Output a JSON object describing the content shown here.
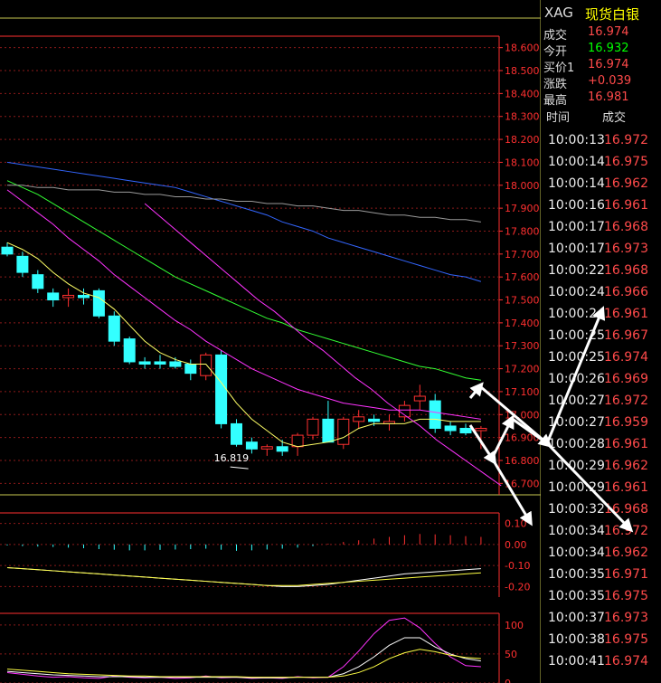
{
  "symbol": {
    "code": "XAG",
    "name": "现货白银"
  },
  "quote": {
    "rows": [
      {
        "label": "成交",
        "value": "16.974",
        "color": "#ff4a4a"
      },
      {
        "label": "今开",
        "value": "16.932",
        "color": "#00ff00"
      },
      {
        "label": "买价1",
        "value": "16.974",
        "color": "#ff4a4a"
      },
      {
        "label": "涨跌",
        "value": "+0.039",
        "color": "#ff4a4a"
      },
      {
        "label": "最高",
        "value": "16.981",
        "color": "#ff4a4a"
      }
    ]
  },
  "ticks": {
    "header_time": "时间",
    "header_price": "成交",
    "rows": [
      {
        "time": "10:00:13",
        "price": "16.972"
      },
      {
        "time": "10:00:14",
        "price": "16.975"
      },
      {
        "time": "10:00:14",
        "price": "16.962"
      },
      {
        "time": "10:00:16",
        "price": "16.961"
      },
      {
        "time": "10:00:17",
        "price": "16.968"
      },
      {
        "time": "10:00:17",
        "price": "16.973"
      },
      {
        "time": "10:00:22",
        "price": "16.968"
      },
      {
        "time": "10:00:24",
        "price": "16.966"
      },
      {
        "time": "10:00:24",
        "price": "16.961"
      },
      {
        "time": "10:00:25",
        "price": "16.967"
      },
      {
        "time": "10:00:25",
        "price": "16.974"
      },
      {
        "time": "10:00:26",
        "price": "16.969"
      },
      {
        "time": "10:00:27",
        "price": "16.972"
      },
      {
        "time": "10:00:27",
        "price": "16.959"
      },
      {
        "time": "10:00:28",
        "price": "16.961"
      },
      {
        "time": "10:00:29",
        "price": "16.962"
      },
      {
        "time": "10:00:29",
        "price": "16.961"
      },
      {
        "time": "10:00:32",
        "price": "16.968"
      },
      {
        "time": "10:00:34",
        "price": "16.972"
      },
      {
        "time": "10:00:34",
        "price": "16.962"
      },
      {
        "time": "10:00:35",
        "price": "16.971"
      },
      {
        "time": "10:00:35",
        "price": "16.975"
      },
      {
        "time": "10:00:37",
        "price": "16.973"
      },
      {
        "time": "10:00:38",
        "price": "16.975"
      },
      {
        "time": "10:00:41",
        "price": "16.974"
      }
    ]
  },
  "colors": {
    "up": "#ff3030",
    "down": "#33ffff",
    "grid": "#8b1a1a",
    "axis": "#ff3030"
  },
  "chart_data": {
    "type": "candlestick",
    "ylim": [
      16.65,
      18.65
    ],
    "yticks": [
      "18.600",
      "18.500",
      "18.400",
      "18.300",
      "18.200",
      "18.100",
      "18.000",
      "17.900",
      "17.800",
      "17.700",
      "17.600",
      "17.500",
      "17.400",
      "17.300",
      "17.200",
      "17.100",
      "17.000",
      "16.900",
      "16.800",
      "16.700"
    ],
    "low_annotation": {
      "label": "16.819",
      "index": 14,
      "value": 16.819
    },
    "candles": [
      {
        "o": 17.73,
        "h": 17.75,
        "l": 17.69,
        "c": 17.7
      },
      {
        "o": 17.69,
        "h": 17.71,
        "l": 17.6,
        "c": 17.62
      },
      {
        "o": 17.61,
        "h": 17.63,
        "l": 17.53,
        "c": 17.55
      },
      {
        "o": 17.53,
        "h": 17.55,
        "l": 17.47,
        "c": 17.5
      },
      {
        "o": 17.51,
        "h": 17.55,
        "l": 17.47,
        "c": 17.52
      },
      {
        "o": 17.52,
        "h": 17.55,
        "l": 17.48,
        "c": 17.51
      },
      {
        "o": 17.54,
        "h": 17.55,
        "l": 17.42,
        "c": 17.43
      },
      {
        "o": 17.43,
        "h": 17.45,
        "l": 17.3,
        "c": 17.32
      },
      {
        "o": 17.33,
        "h": 17.34,
        "l": 17.22,
        "c": 17.23
      },
      {
        "o": 17.23,
        "h": 17.25,
        "l": 17.2,
        "c": 17.22
      },
      {
        "o": 17.23,
        "h": 17.26,
        "l": 17.2,
        "c": 17.22
      },
      {
        "o": 17.23,
        "h": 17.25,
        "l": 17.2,
        "c": 17.21
      },
      {
        "o": 17.22,
        "h": 17.24,
        "l": 17.15,
        "c": 17.18
      },
      {
        "o": 17.17,
        "h": 17.27,
        "l": 17.15,
        "c": 17.26
      },
      {
        "o": 17.26,
        "h": 17.28,
        "l": 16.94,
        "c": 16.96
      },
      {
        "o": 16.96,
        "h": 16.98,
        "l": 16.86,
        "c": 16.87
      },
      {
        "o": 16.88,
        "h": 16.9,
        "l": 16.83,
        "c": 16.85
      },
      {
        "o": 16.85,
        "h": 16.87,
        "l": 16.82,
        "c": 16.86
      },
      {
        "o": 16.86,
        "h": 16.89,
        "l": 16.82,
        "c": 16.84
      },
      {
        "o": 16.86,
        "h": 16.92,
        "l": 16.82,
        "c": 16.91
      },
      {
        "o": 16.91,
        "h": 16.99,
        "l": 16.89,
        "c": 16.98
      },
      {
        "o": 16.98,
        "h": 17.06,
        "l": 16.88,
        "c": 16.88
      },
      {
        "o": 16.87,
        "h": 16.99,
        "l": 16.85,
        "c": 16.98
      },
      {
        "o": 16.97,
        "h": 17.02,
        "l": 16.94,
        "c": 16.99
      },
      {
        "o": 16.98,
        "h": 17.0,
        "l": 16.95,
        "c": 16.97
      },
      {
        "o": 16.96,
        "h": 17.0,
        "l": 16.93,
        "c": 16.97
      },
      {
        "o": 16.99,
        "h": 17.06,
        "l": 16.97,
        "c": 17.04
      },
      {
        "o": 17.06,
        "h": 17.13,
        "l": 17.02,
        "c": 17.08
      },
      {
        "o": 17.06,
        "h": 17.09,
        "l": 16.92,
        "c": 16.94
      },
      {
        "o": 16.95,
        "h": 16.97,
        "l": 16.91,
        "c": 16.93
      },
      {
        "o": 16.94,
        "h": 16.96,
        "l": 16.91,
        "c": 16.92
      },
      {
        "o": 16.93,
        "h": 16.95,
        "l": 16.85,
        "c": 16.94
      }
    ],
    "moving_averages": [
      {
        "color": "#ffff66",
        "values": [
          17.75,
          17.72,
          17.68,
          17.62,
          17.57,
          17.53,
          17.51,
          17.46,
          17.39,
          17.32,
          17.27,
          17.24,
          17.22,
          17.22,
          17.14,
          17.05,
          16.98,
          16.93,
          16.88,
          16.86,
          16.87,
          16.88,
          16.9,
          16.94,
          16.96,
          16.96,
          16.96,
          16.98,
          16.98,
          16.97,
          16.97,
          16.97
        ]
      },
      {
        "color": "#ff33ff",
        "values": [
          17.98,
          17.93,
          17.88,
          17.83,
          17.77,
          17.72,
          17.67,
          17.61,
          17.56,
          17.51,
          17.46,
          17.41,
          17.37,
          17.32,
          17.28,
          17.24,
          17.2,
          17.17,
          17.14,
          17.11,
          17.09,
          17.07,
          17.05,
          17.04,
          17.03,
          17.02,
          17.02,
          17.02,
          17.01,
          17.0,
          16.99,
          16.98
        ]
      },
      {
        "color": "#33ff33",
        "values": [
          18.02,
          17.99,
          17.96,
          17.92,
          17.88,
          17.84,
          17.8,
          17.76,
          17.72,
          17.68,
          17.64,
          17.6,
          17.57,
          17.54,
          17.51,
          17.48,
          17.45,
          17.42,
          17.4,
          17.37,
          17.35,
          17.33,
          17.31,
          17.29,
          17.27,
          17.25,
          17.23,
          17.21,
          17.2,
          17.18,
          17.16,
          17.15
        ]
      },
      {
        "color": "#3366ff",
        "values": [
          18.1,
          18.09,
          18.08,
          18.07,
          18.06,
          18.05,
          18.04,
          18.03,
          18.02,
          18.01,
          18.0,
          17.99,
          17.97,
          17.95,
          17.93,
          17.91,
          17.89,
          17.87,
          17.84,
          17.82,
          17.8,
          17.77,
          17.75,
          17.73,
          17.71,
          17.69,
          17.67,
          17.65,
          17.63,
          17.61,
          17.6,
          17.58
        ]
      },
      {
        "color": "#9a9a9a",
        "values": [
          18.0,
          18.0,
          17.99,
          17.99,
          17.98,
          17.98,
          17.98,
          17.97,
          17.97,
          17.96,
          17.96,
          17.95,
          17.95,
          17.94,
          17.94,
          17.93,
          17.93,
          17.92,
          17.92,
          17.91,
          17.91,
          17.9,
          17.89,
          17.89,
          17.88,
          17.87,
          17.87,
          17.86,
          17.86,
          17.85,
          17.85,
          17.84
        ]
      }
    ],
    "channel": {
      "color": "#ff33ff",
      "values": [
        17.92,
        17.86,
        17.8,
        17.74,
        17.68,
        17.62,
        17.56,
        17.5,
        17.45,
        17.39,
        17.33,
        17.28,
        17.22,
        17.16,
        17.11,
        17.05,
        17.0,
        16.95,
        16.89,
        16.84,
        16.79,
        16.74,
        16.69
      ]
    },
    "macd": {
      "ylim": [
        -0.25,
        0.15
      ],
      "yticks": [
        "0.10",
        "0.00",
        "-0.10",
        "-0.20"
      ],
      "hist": [
        -0.005,
        -0.008,
        -0.01,
        -0.012,
        -0.015,
        -0.018,
        -0.022,
        -0.025,
        -0.028,
        -0.028,
        -0.026,
        -0.024,
        -0.022,
        -0.02,
        -0.025,
        -0.03,
        -0.028,
        -0.024,
        -0.02,
        -0.015,
        -0.008,
        0.004,
        0.012,
        0.02,
        0.028,
        0.036,
        0.044,
        0.05,
        0.048,
        0.044,
        0.04,
        0.036
      ],
      "lines": [
        {
          "color": "#ffffff",
          "values": [
            -0.11,
            -0.115,
            -0.12,
            -0.125,
            -0.13,
            -0.135,
            -0.14,
            -0.145,
            -0.15,
            -0.155,
            -0.16,
            -0.165,
            -0.17,
            -0.175,
            -0.18,
            -0.185,
            -0.19,
            -0.195,
            -0.2,
            -0.2,
            -0.195,
            -0.19,
            -0.18,
            -0.17,
            -0.16,
            -0.15,
            -0.14,
            -0.135,
            -0.13,
            -0.125,
            -0.12,
            -0.115
          ]
        },
        {
          "color": "#ffff44",
          "values": [
            -0.11,
            -0.115,
            -0.12,
            -0.125,
            -0.13,
            -0.135,
            -0.14,
            -0.145,
            -0.15,
            -0.155,
            -0.16,
            -0.165,
            -0.17,
            -0.175,
            -0.18,
            -0.185,
            -0.19,
            -0.195,
            -0.195,
            -0.195,
            -0.19,
            -0.185,
            -0.18,
            -0.175,
            -0.17,
            -0.165,
            -0.16,
            -0.155,
            -0.15,
            -0.145,
            -0.14,
            -0.135
          ]
        }
      ]
    },
    "kdj": {
      "ylim": [
        0,
        120
      ],
      "yticks": [
        "100",
        "50",
        "0"
      ],
      "lines": [
        {
          "color": "#ff33ff",
          "values": [
            18,
            15,
            12,
            10,
            11,
            9,
            8,
            12,
            10,
            9,
            10,
            8,
            9,
            12,
            9,
            10,
            8,
            9,
            8,
            11,
            9,
            10,
            28,
            55,
            85,
            108,
            112,
            95,
            68,
            45,
            30,
            28
          ]
        },
        {
          "color": "#ffffff",
          "values": [
            20,
            18,
            16,
            14,
            13,
            12,
            11,
            11,
            11,
            10,
            10,
            10,
            10,
            10,
            10,
            10,
            9,
            9,
            9,
            10,
            10,
            10,
            16,
            28,
            45,
            65,
            78,
            78,
            62,
            50,
            42,
            38
          ]
        },
        {
          "color": "#ffff44",
          "values": [
            24,
            22,
            20,
            18,
            16,
            15,
            14,
            13,
            12,
            12,
            11,
            11,
            11,
            11,
            11,
            11,
            10,
            10,
            10,
            10,
            10,
            10,
            12,
            18,
            28,
            42,
            52,
            58,
            54,
            48,
            44,
            42
          ]
        }
      ]
    }
  }
}
